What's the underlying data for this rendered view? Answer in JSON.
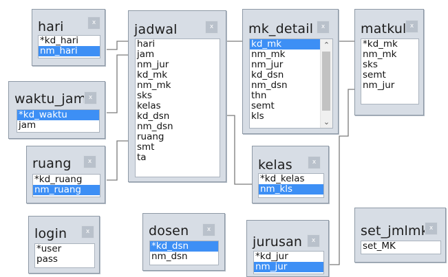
{
  "tables": {
    "hari": {
      "title": "hari",
      "close": "x",
      "fields": [
        "*kd_hari",
        "nm_hari"
      ]
    },
    "waktu_jam": {
      "title": "waktu_jam",
      "close": "x",
      "fields": [
        "*kd_waktu",
        "jam"
      ]
    },
    "ruang": {
      "title": "ruang",
      "close": "x",
      "fields": [
        "*kd_ruang",
        "nm_ruang"
      ]
    },
    "login": {
      "title": "login",
      "close": "x",
      "fields": [
        "*user",
        "pass"
      ]
    },
    "jadwal": {
      "title": "jadwal",
      "close": "x",
      "fields": [
        "hari",
        "jam",
        "nm_jur",
        "kd_mk",
        "nm_mk",
        "sks",
        "kelas",
        "kd_dsn",
        "nm_dsn",
        "ruang",
        "smt",
        "ta"
      ]
    },
    "dosen": {
      "title": "dosen",
      "close": "x",
      "fields": [
        "*kd_dsn",
        "nm_dsn"
      ]
    },
    "mk_detail": {
      "title": "mk_detail",
      "close": "x",
      "fields": [
        "kd_mk",
        "nm_mk",
        "nm_jur",
        "kd_dsn",
        "nm_dsn",
        "thn",
        "semt",
        "kls"
      ]
    },
    "kelas": {
      "title": "kelas",
      "close": "x",
      "fields": [
        "*kd_kelas",
        "nm_kls"
      ]
    },
    "jurusan": {
      "title": "jurusan",
      "close": "x",
      "fields": [
        "*kd_jur",
        "nm_jur"
      ]
    },
    "matkul": {
      "title": "matkul",
      "close": "x",
      "fields": [
        "*kd_mk",
        "nm_mk",
        "sks",
        "semt",
        "nm_jur"
      ]
    },
    "set_jmlmk": {
      "title": "set_jmlmk",
      "close": "x",
      "fields": [
        "set_MK"
      ]
    }
  },
  "colors": {
    "panel": "#d7dde5",
    "selection": "#3d8ff5",
    "link": "#777777"
  }
}
